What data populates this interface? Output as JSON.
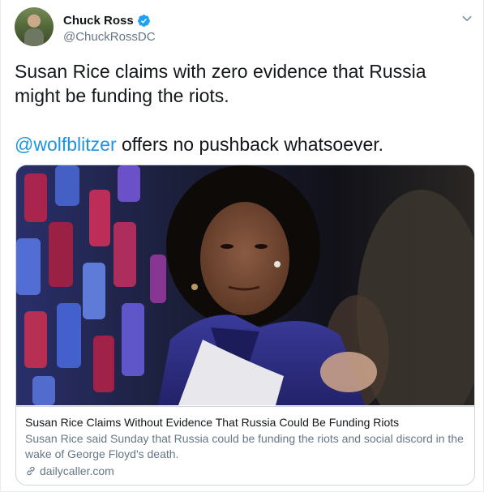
{
  "author": {
    "display_name": "Chuck Ross",
    "handle": "@ChuckRossDC",
    "verified": true
  },
  "icons": {
    "avatar": "profile-photo",
    "verified": "verified-badge-icon",
    "menu": "chevron-down-icon",
    "link": "link-icon"
  },
  "tweet": {
    "line1": "Susan Rice claims with zero evidence that Russia might be funding the riots.",
    "mention": "@wolfblitzer",
    "line2_rest": " offers no pushback whatsoever."
  },
  "card": {
    "title": "Susan Rice Claims Without Evidence That Russia Could Be Funding Riots",
    "description": "Susan Rice said Sunday that Russia could be funding the riots and social discord in the wake of George Floyd's death.",
    "domain": "dailycaller.com"
  },
  "colors": {
    "link_blue": "#1b95e0",
    "verified_blue": "#1da1f2",
    "secondary_text": "#657786",
    "border": "#ccd6dd"
  }
}
